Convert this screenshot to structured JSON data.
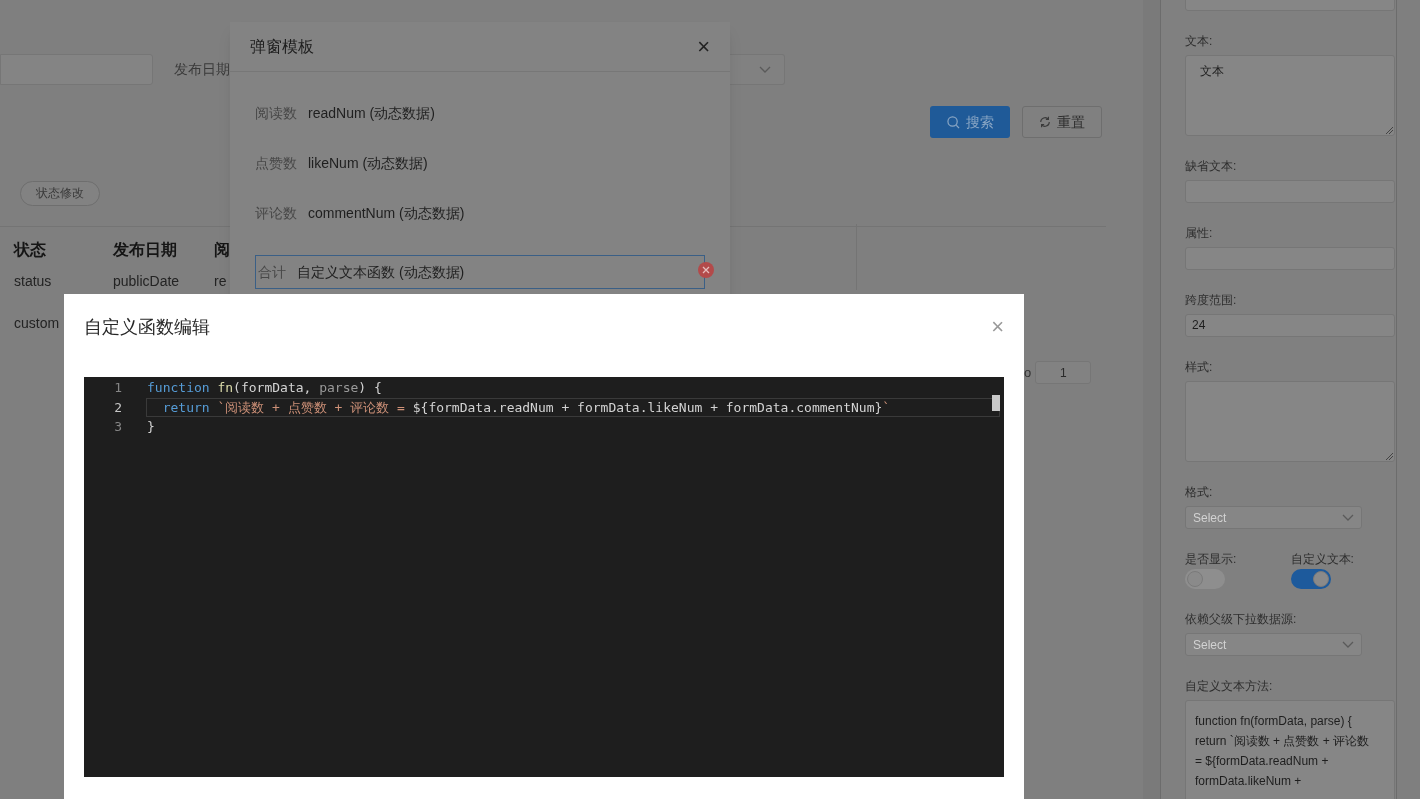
{
  "filter_bar": {
    "date_label": "发布日期",
    "search_button": "搜索",
    "reset_button": "重置"
  },
  "toolbar": {
    "status_button": "状态修改"
  },
  "table": {
    "columns": [
      "状态",
      "发布日期",
      "阅"
    ],
    "rows": [
      [
        "status",
        "publicDate",
        "re"
      ],
      [
        "custom"
      ]
    ]
  },
  "pagination": {
    "partial_label": "o",
    "page": "1"
  },
  "template_dialog": {
    "title": "弹窗模板",
    "close": "×",
    "items": [
      {
        "label": "阅读数",
        "value": "readNum (动态数据)",
        "selected": false
      },
      {
        "label": "点赞数",
        "value": "likeNum (动态数据)",
        "selected": false
      },
      {
        "label": "评论数",
        "value": "commentNum (动态数据)",
        "selected": false
      },
      {
        "label": "合计",
        "value": "自定义文本函数 (动态数据)",
        "selected": true
      }
    ]
  },
  "function_dialog": {
    "title": "自定义函数编辑",
    "close": "×",
    "code": [
      {
        "number": "1",
        "current": false,
        "tokens": [
          {
            "kind": "keyword",
            "text": "function"
          },
          {
            "kind": "function",
            "text": " fn"
          },
          {
            "kind": "plain",
            "text": "(formData, "
          },
          {
            "kind": "param",
            "text": "parse"
          },
          {
            "kind": "plain",
            "text": ") {"
          }
        ]
      },
      {
        "number": "2",
        "current": true,
        "tokens": [
          {
            "kind": "keyword",
            "text": "  return"
          },
          {
            "kind": "string",
            "text": " `阅读数 + 点赞数 + 评论数 = "
          },
          {
            "kind": "plain",
            "text": "${"
          },
          {
            "kind": "plain",
            "text": "formData.readNum + formData.likeNum + formData.commentNum"
          },
          {
            "kind": "plain",
            "text": "}"
          },
          {
            "kind": "string",
            "text": "`"
          }
        ]
      },
      {
        "number": "3",
        "current": false,
        "tokens": [
          {
            "kind": "plain",
            "text": "}"
          }
        ]
      }
    ]
  },
  "properties_panel": {
    "fields": [
      {
        "kind": "input"
      },
      {
        "kind": "textarea",
        "label": "文本:",
        "lines": [
          "文本"
        ]
      },
      {
        "kind": "input",
        "label": "缺省文本:"
      },
      {
        "kind": "input",
        "label": "属性:"
      },
      {
        "kind": "input",
        "label": "跨度范围:",
        "value": "24"
      },
      {
        "kind": "textarea",
        "label": "样式:"
      },
      {
        "kind": "select",
        "label": "格式:",
        "placeholder": "Select"
      },
      {
        "kind": "switches",
        "items": [
          {
            "label": "是否显示:",
            "on": false
          },
          {
            "label": "自定义文本:",
            "on": true
          }
        ]
      },
      {
        "kind": "select",
        "label": "依赖父级下拉数据源:",
        "placeholder": "Select"
      },
      {
        "kind": "code",
        "label": "自定义文本方法:",
        "lines": [
          "function fn(formData, parse) {",
          "return `阅读数 + 点赞数 + 评论数",
          "= ${formData.readNum +",
          "formData.likeNum +"
        ]
      }
    ]
  }
}
